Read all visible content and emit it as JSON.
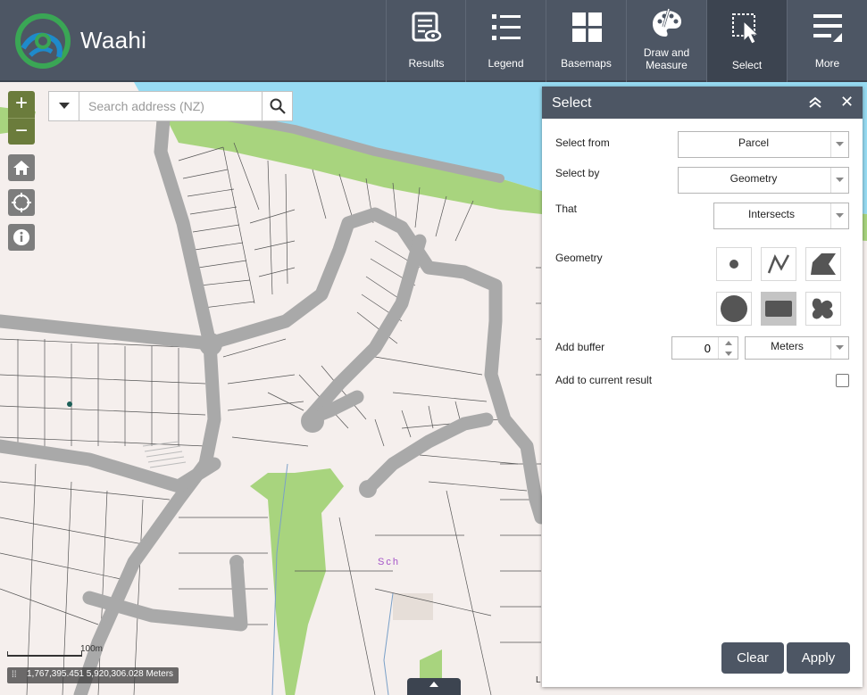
{
  "header": {
    "app_title": "Waahi",
    "tools": [
      {
        "label": "Results",
        "icon": "results-icon"
      },
      {
        "label": "Legend",
        "icon": "legend-icon"
      },
      {
        "label": "Basemaps",
        "icon": "basemaps-icon"
      },
      {
        "label": "Draw and Measure",
        "icon": "palette-icon"
      },
      {
        "label": "Select",
        "icon": "select-cursor-icon",
        "active": true
      },
      {
        "label": "More",
        "icon": "more-icon"
      }
    ]
  },
  "map": {
    "zoom_in_label": "+",
    "zoom_out_label": "−",
    "search_placeholder": "Search address (NZ)",
    "label_school": "Sch",
    "scale_text": "100m",
    "coordinates": "1,767,395.451 5,920,306.028 Meters",
    "attribution_fragment": "L"
  },
  "select_panel": {
    "title": "Select",
    "select_from_label": "Select from",
    "select_from_value": "Parcel",
    "select_by_label": "Select by",
    "select_by_value": "Geometry",
    "that_label": "That",
    "that_value": "Intersects",
    "geometry_label": "Geometry",
    "geometry_tools": [
      {
        "name": "point-icon"
      },
      {
        "name": "polyline-icon"
      },
      {
        "name": "polygon-icon"
      },
      {
        "name": "circle-icon"
      },
      {
        "name": "rectangle-icon",
        "selected": true
      },
      {
        "name": "freehand-polygon-icon"
      }
    ],
    "buffer_label": "Add buffer",
    "buffer_value": "0",
    "buffer_unit": "Meters",
    "add_to_result_label": "Add to current result",
    "add_to_result_checked": false,
    "clear_label": "Clear",
    "apply_label": "Apply"
  },
  "colors": {
    "header_bg": "#4d5664",
    "water": "#97dbf2",
    "park": "#a8d47e",
    "road": "#a9a9a9",
    "land": "#f5efed",
    "zoom_green": "#6b7c3c"
  }
}
